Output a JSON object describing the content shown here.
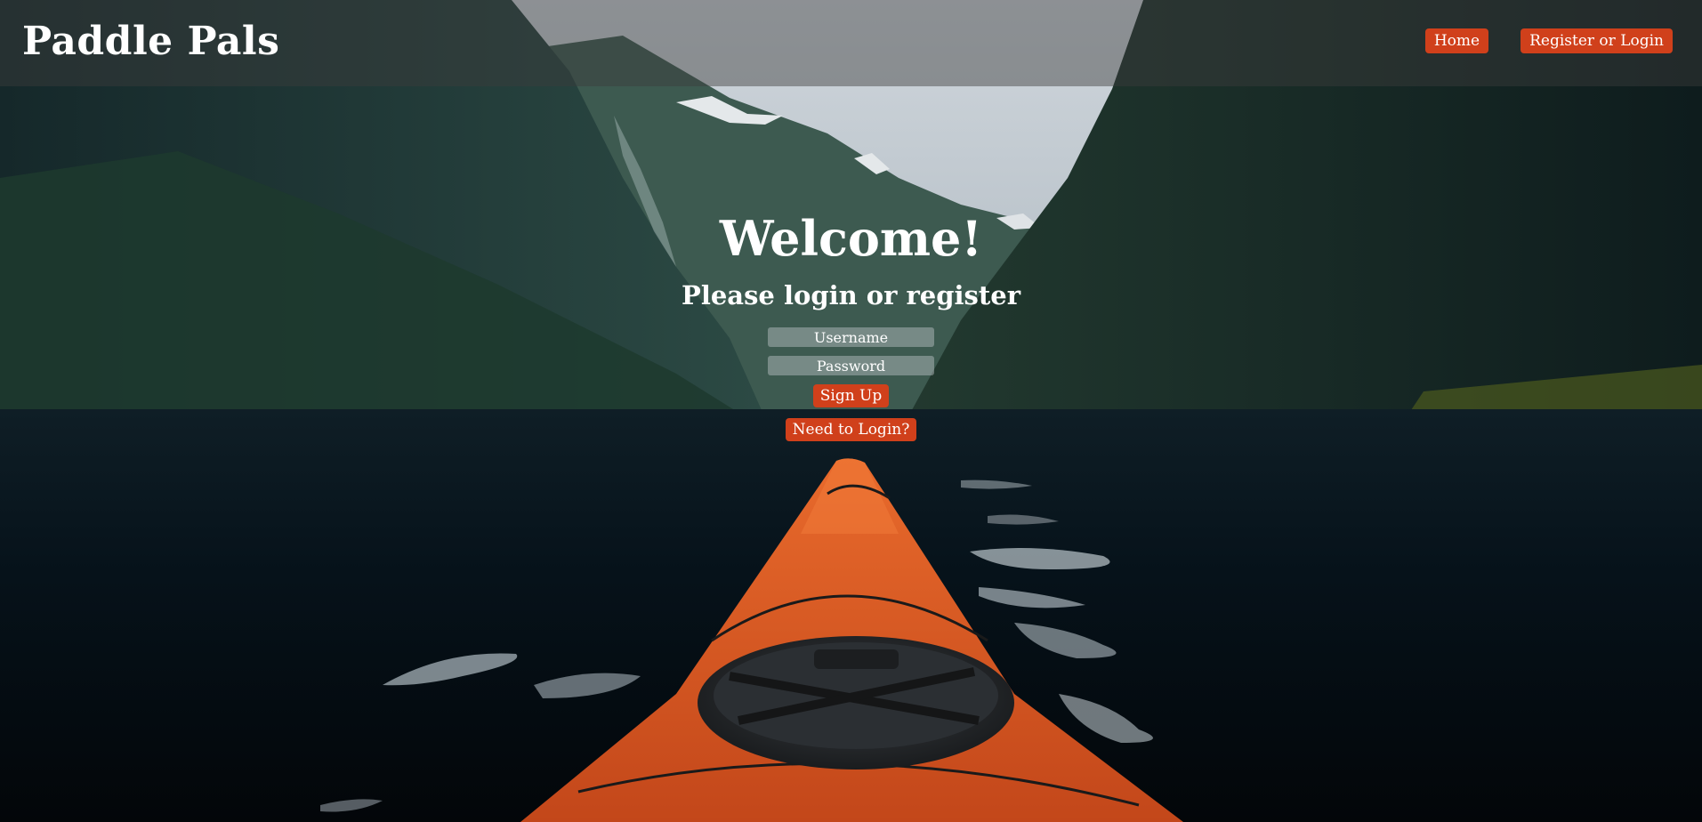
{
  "nav": {
    "brand": "Paddle Pals",
    "home_label": "Home",
    "register_login_label": "Register or Login"
  },
  "hero": {
    "title": "Welcome!",
    "subtitle": "Please login or register"
  },
  "form": {
    "username_placeholder": "Username",
    "password_placeholder": "Password",
    "signup_label": "Sign Up",
    "login_link_label": "Need to Login?"
  },
  "colors": {
    "accent": "#d0401b",
    "text": "#ffffff"
  },
  "background": {
    "scene": "fjord-with-orange-kayak-bow-photo"
  }
}
